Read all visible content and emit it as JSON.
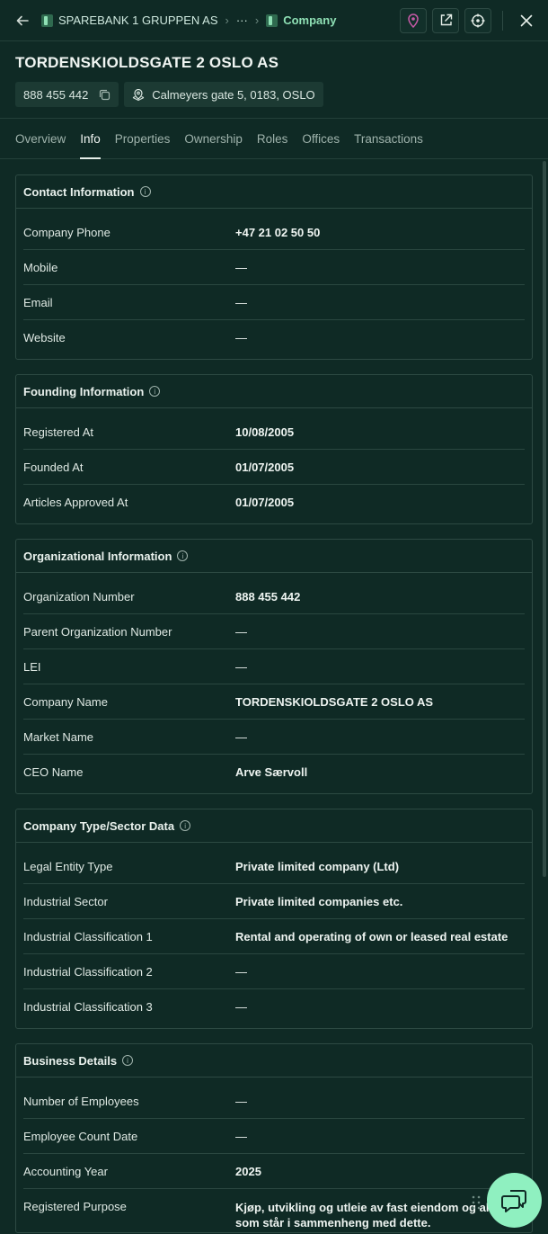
{
  "breadcrumb": {
    "items": [
      {
        "label": "SPAREBANK 1 GRUPPEN AS"
      },
      {
        "label": "···"
      },
      {
        "label": "Company"
      }
    ]
  },
  "company": {
    "title": "TORDENSKIOLDSGATE 2 OSLO AS",
    "org_number": "888 455 442",
    "address": "Calmeyers gate 5, 0183, OSLO"
  },
  "tabs": [
    {
      "label": "Overview"
    },
    {
      "label": "Info",
      "active": true
    },
    {
      "label": "Properties"
    },
    {
      "label": "Ownership"
    },
    {
      "label": "Roles"
    },
    {
      "label": "Offices"
    },
    {
      "label": "Transactions"
    }
  ],
  "sections": {
    "contact": {
      "title": "Contact Information",
      "rows": [
        {
          "label": "Company Phone",
          "value": "+47 21 02 50 50"
        },
        {
          "label": "Mobile",
          "value": "—"
        },
        {
          "label": "Email",
          "value": "—"
        },
        {
          "label": "Website",
          "value": "—"
        }
      ]
    },
    "founding": {
      "title": "Founding Information",
      "rows": [
        {
          "label": "Registered At",
          "value": "10/08/2005"
        },
        {
          "label": "Founded At",
          "value": "01/07/2005"
        },
        {
          "label": "Articles Approved At",
          "value": "01/07/2005"
        }
      ]
    },
    "organizational": {
      "title": "Organizational Information",
      "rows": [
        {
          "label": "Organization Number",
          "value": "888 455 442"
        },
        {
          "label": "Parent Organization Number",
          "value": "—"
        },
        {
          "label": "LEI",
          "value": "—"
        },
        {
          "label": "Company Name",
          "value": "TORDENSKIOLDSGATE 2 OSLO AS"
        },
        {
          "label": "Market Name",
          "value": "—"
        },
        {
          "label": "CEO Name",
          "value": "Arve Særvoll"
        }
      ]
    },
    "type_sector": {
      "title": "Company Type/Sector Data",
      "rows": [
        {
          "label": "Legal Entity Type",
          "value": "Private limited company (Ltd)"
        },
        {
          "label": "Industrial Sector",
          "value": "Private limited companies etc."
        },
        {
          "label": "Industrial Classification 1",
          "value": "Rental and operating of own or leased real estate"
        },
        {
          "label": "Industrial Classification 2",
          "value": "—"
        },
        {
          "label": "Industrial Classification 3",
          "value": "—"
        }
      ]
    },
    "business": {
      "title": "Business Details",
      "rows": [
        {
          "label": "Number of Employees",
          "value": "—"
        },
        {
          "label": "Employee Count Date",
          "value": "—"
        },
        {
          "label": "Accounting Year",
          "value": "2025"
        },
        {
          "label": "Registered Purpose",
          "value": "Kjøp, utvikling og utleie av fast eiendom og alt som står i sammenheng med dette."
        }
      ]
    }
  },
  "colors": {
    "background": "#0f2a25",
    "accent": "#8fe0b5",
    "fab": "#8ff0c0",
    "location_pin": "#c85aa8"
  },
  "icons": {
    "back": "arrow-left-icon",
    "building": "building-icon",
    "location": "location-pin-icon",
    "open_external": "external-link-icon",
    "target": "crosshair-icon",
    "close": "close-icon",
    "copy": "copy-icon",
    "map": "map-pin-icon",
    "info": "info-icon",
    "chat": "chat-icon"
  }
}
